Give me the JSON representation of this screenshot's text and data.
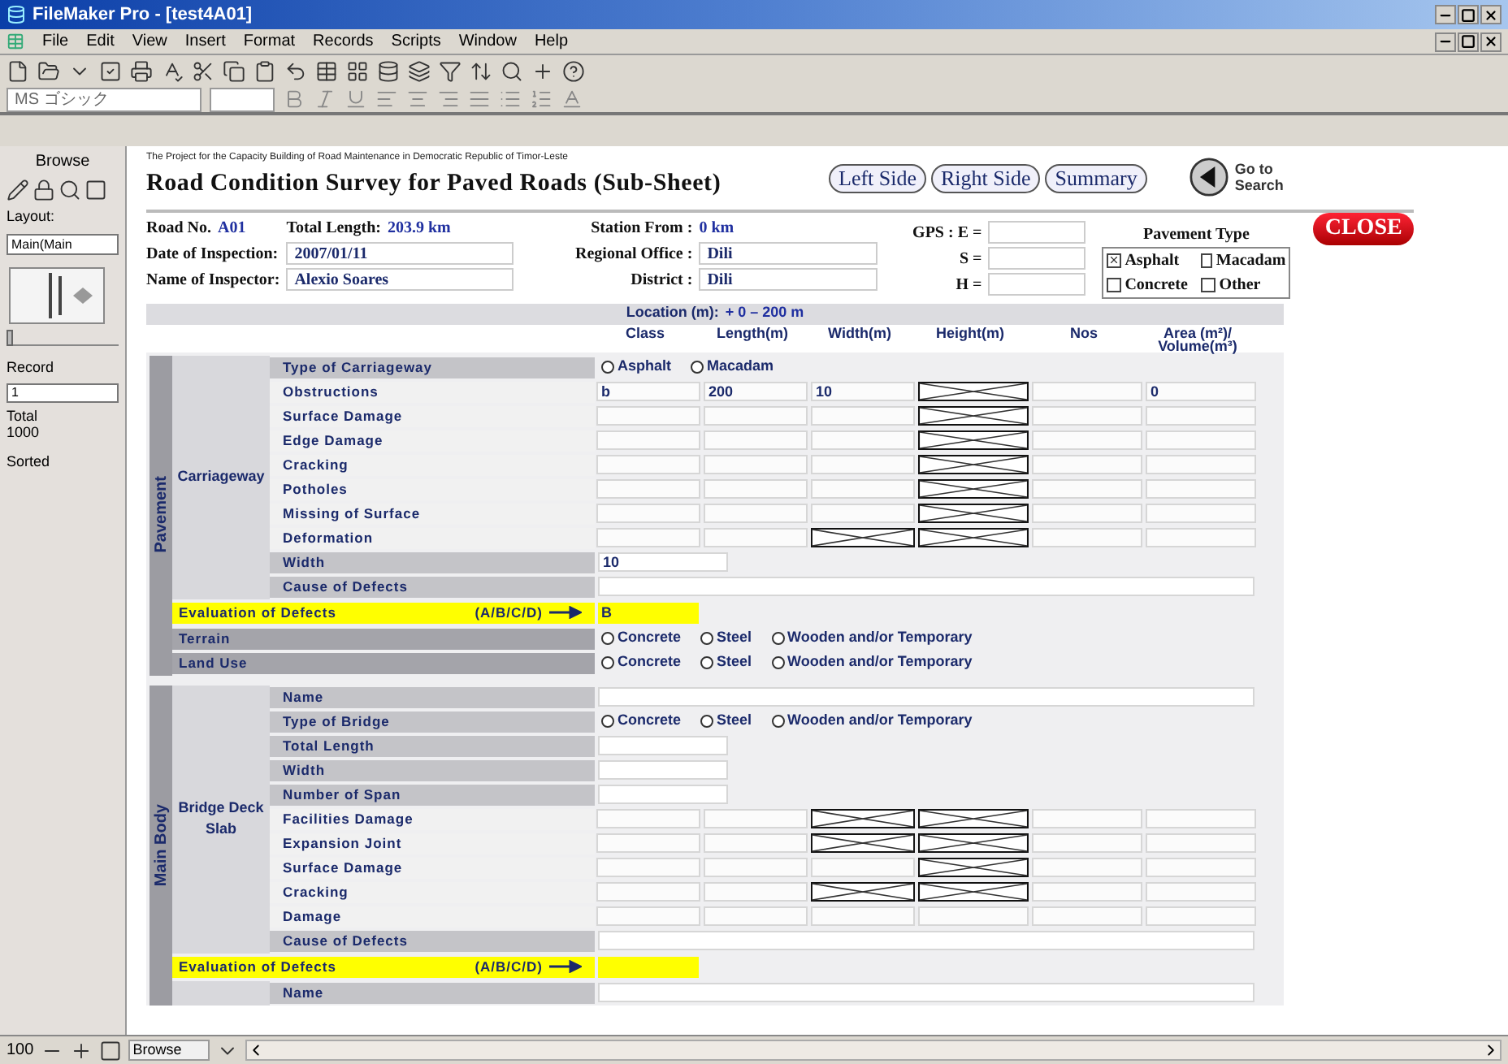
{
  "window": {
    "title": "FileMaker Pro - [test4A01]"
  },
  "menu": [
    "File",
    "Edit",
    "View",
    "Insert",
    "Format",
    "Records",
    "Scripts",
    "Window",
    "Help"
  ],
  "format_bar": {
    "font": "MS ゴシック"
  },
  "sidebar": {
    "mode": "Browse",
    "layout_label": "Layout:",
    "layout": "Main(Main",
    "record_slider": {
      "level": 0
    },
    "record_label": "Record",
    "record": "1",
    "total_label": "Total",
    "total": "1000",
    "sort_status": "Sorted"
  },
  "header": {
    "subtitle": "The Project for the Capacity Building of Road Maintenance in Democratic Republic of Timor-Leste",
    "title": "Road Condition Survey for Paved Roads (Sub-Sheet)",
    "nav_buttons": [
      "Left Side",
      "Right Side",
      "Summary"
    ],
    "search_link": "Go to Search",
    "close_button": "CLOSE"
  },
  "info": {
    "road_no_label": "Road No.",
    "road_no": "A01",
    "total_length_label": "Total Length:",
    "total_length": "203.9 km",
    "station_label": "Station From :",
    "station": "0 km",
    "date_label": "Date of Inspection:",
    "date": "2007/01/11",
    "office_label": "Regional Office :",
    "office": "Dili",
    "inspector_label": "Name of Inspector:",
    "inspector": "Alexio Soares",
    "district_label": "District :",
    "district": "Dili",
    "gps_fields": [
      {
        "label": "GPS : E ="
      },
      {
        "label": "S ="
      },
      {
        "label": "H ="
      }
    ]
  },
  "pavement_type": {
    "title": "Pavement Type",
    "options": [
      {
        "label": "Asphalt",
        "checked": true
      },
      {
        "label": "Macadam",
        "checked": false
      },
      {
        "label": "Concrete",
        "checked": false
      },
      {
        "label": "Other",
        "checked": false
      }
    ]
  },
  "location": {
    "label": "Location (m):",
    "range": "+ 0 – 200 m"
  },
  "columns": [
    "Class",
    "Length(m)",
    "Width(m)",
    "Height(m)",
    "Nos",
    "Area (m²)/ Volume(m³)"
  ],
  "sections": [
    {
      "label": "Pavement",
      "blocks": [
        {
          "kind": "group",
          "label": "Carriageway",
          "rows": [
            {
              "kind": "options",
              "label": "Type of Carriageway",
              "shaded": true,
              "options": [
                {
                  "label": "Asphalt",
                  "selected": false
                },
                {
                  "label": "Macadam",
                  "selected": false
                }
              ]
            },
            {
              "kind": "measure",
              "label": "Obstructions",
              "shaded": false,
              "cells": [
                {
                  "value": "b",
                  "crossed": false
                },
                {
                  "value": "200",
                  "crossed": false
                },
                {
                  "value": "10",
                  "crossed": false
                },
                {
                  "crossed": true
                },
                {
                  "crossed": false
                },
                {
                  "value": "0",
                  "crossed": false
                }
              ]
            },
            {
              "kind": "measure",
              "label": "Surface Damage",
              "shaded": false,
              "cells": [
                {
                  "crossed": false
                },
                {
                  "crossed": false
                },
                {
                  "crossed": false
                },
                {
                  "crossed": true
                },
                {
                  "crossed": false
                },
                {
                  "crossed": false
                }
              ]
            },
            {
              "kind": "measure",
              "label": "Edge Damage",
              "shaded": false,
              "cells": [
                {
                  "crossed": false
                },
                {
                  "crossed": false
                },
                {
                  "crossed": false
                },
                {
                  "crossed": true
                },
                {
                  "crossed": false
                },
                {
                  "crossed": false
                }
              ]
            },
            {
              "kind": "measure",
              "label": "Cracking",
              "shaded": false,
              "cells": [
                {
                  "crossed": false
                },
                {
                  "crossed": false
                },
                {
                  "crossed": false
                },
                {
                  "crossed": true
                },
                {
                  "crossed": false
                },
                {
                  "crossed": false
                }
              ]
            },
            {
              "kind": "measure",
              "label": "Potholes",
              "shaded": false,
              "cells": [
                {
                  "crossed": false
                },
                {
                  "crossed": false
                },
                {
                  "crossed": false
                },
                {
                  "crossed": true
                },
                {
                  "crossed": false
                },
                {
                  "crossed": false
                }
              ]
            },
            {
              "kind": "measure",
              "label": "Missing of Surface",
              "shaded": false,
              "cells": [
                {
                  "crossed": false
                },
                {
                  "crossed": false
                },
                {
                  "crossed": false
                },
                {
                  "crossed": true
                },
                {
                  "crossed": false
                },
                {
                  "crossed": false
                }
              ]
            },
            {
              "kind": "measure",
              "label": "Deformation",
              "shaded": false,
              "cells": [
                {
                  "crossed": false
                },
                {
                  "crossed": false
                },
                {
                  "crossed": true
                },
                {
                  "crossed": true
                },
                {
                  "crossed": false
                },
                {
                  "crossed": false
                }
              ]
            },
            {
              "kind": "single",
              "label": "Width",
              "shaded": true,
              "value": "10"
            },
            {
              "kind": "wide",
              "label": "Cause of Defects",
              "shaded": true
            }
          ]
        },
        {
          "kind": "evaluation",
          "label": "Evaluation of Defects",
          "scale": "(A/B/C/D)",
          "value": "B"
        },
        {
          "kind": "band",
          "label": "Terrain",
          "options": [
            {
              "label": "Concrete",
              "selected": false
            },
            {
              "label": "Steel",
              "selected": false
            },
            {
              "label": "Wooden and/or Temporary",
              "selected": false
            }
          ]
        },
        {
          "kind": "band",
          "label": "Land Use",
          "options": [
            {
              "label": "Concrete",
              "selected": false
            },
            {
              "label": "Steel",
              "selected": false
            },
            {
              "label": "Wooden and/or Temporary",
              "selected": false
            }
          ]
        }
      ]
    },
    {
      "label": "Main Body",
      "blocks": [
        {
          "kind": "group",
          "label": "Bridge Deck Slab",
          "rows": [
            {
              "kind": "wide",
              "label": "Name",
              "shaded": true
            },
            {
              "kind": "options",
              "label": "Type of Bridge",
              "shaded": true,
              "options": [
                {
                  "label": "Concrete",
                  "selected": false
                },
                {
                  "label": "Steel",
                  "selected": false
                },
                {
                  "label": "Wooden and/or Temporary",
                  "selected": false
                }
              ]
            },
            {
              "kind": "single",
              "label": "Total Length",
              "shaded": true
            },
            {
              "kind": "single",
              "label": "Width",
              "shaded": true
            },
            {
              "kind": "single",
              "label": "Number of Span",
              "shaded": true
            },
            {
              "kind": "measure",
              "label": "Facilities Damage",
              "shaded": false,
              "cells": [
                {
                  "crossed": false
                },
                {
                  "crossed": false
                },
                {
                  "crossed": true
                },
                {
                  "crossed": true
                },
                {
                  "crossed": false
                },
                {
                  "crossed": false
                }
              ]
            },
            {
              "kind": "measure",
              "label": "Expansion Joint",
              "shaded": false,
              "cells": [
                {
                  "crossed": false
                },
                {
                  "crossed": false
                },
                {
                  "crossed": true
                },
                {
                  "crossed": true
                },
                {
                  "crossed": false
                },
                {
                  "crossed": false
                }
              ]
            },
            {
              "kind": "measure",
              "label": "Surface Damage",
              "shaded": false,
              "cells": [
                {
                  "crossed": false
                },
                {
                  "crossed": false
                },
                {
                  "crossed": false
                },
                {
                  "crossed": true
                },
                {
                  "crossed": false
                },
                {
                  "crossed": false
                }
              ]
            },
            {
              "kind": "measure",
              "label": "Cracking",
              "shaded": false,
              "cells": [
                {
                  "crossed": false
                },
                {
                  "crossed": false
                },
                {
                  "crossed": true
                },
                {
                  "crossed": true
                },
                {
                  "crossed": false
                },
                {
                  "crossed": false
                }
              ]
            },
            {
              "kind": "measure",
              "label": "Damage",
              "shaded": false,
              "cells": [
                {
                  "crossed": false
                },
                {
                  "crossed": false
                },
                {
                  "crossed": false
                },
                {
                  "crossed": false
                },
                {
                  "crossed": false
                },
                {
                  "crossed": false
                }
              ]
            },
            {
              "kind": "wide",
              "label": "Cause of Defects",
              "shaded": true
            }
          ]
        },
        {
          "kind": "evaluation",
          "label": "Evaluation of Defects",
          "scale": "(A/B/C/D)"
        },
        {
          "kind": "group",
          "rows": [
            {
              "kind": "wide",
              "label": "Name",
              "shaded": true
            }
          ]
        }
      ]
    }
  ],
  "status_bar": {
    "zoom": "100",
    "mode": "Browse"
  }
}
